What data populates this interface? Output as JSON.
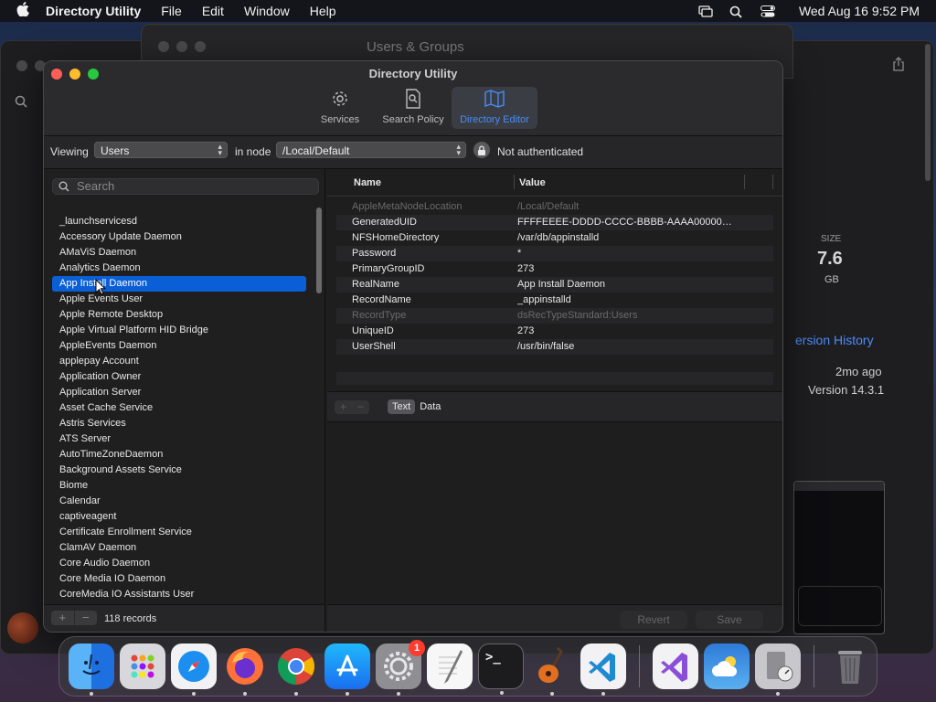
{
  "menubar": {
    "app_name": "Directory Utility",
    "items": [
      "File",
      "Edit",
      "Window",
      "Help"
    ],
    "clock": "Wed Aug 16  9:52 PM"
  },
  "background": {
    "users_groups_title": "Users & Groups",
    "size_label": "SIZE",
    "size_value": "7.6",
    "size_unit": "GB",
    "version_history": "ersion History",
    "ago": "2mo ago",
    "version": "Version 14.3.1"
  },
  "window": {
    "title": "Directory Utility",
    "toolbar": {
      "services": "Services",
      "search_policy": "Search Policy",
      "directory_editor": "Directory Editor"
    },
    "viewing_label": "Viewing",
    "viewing_value": "Users",
    "in_node_label": "in node",
    "node_value": "/Local/Default",
    "auth_status": "Not authenticated"
  },
  "left": {
    "search_placeholder": "Search",
    "records": [
      "_launchservicesd",
      "Accessory Update Daemon",
      "AMaViS Daemon",
      "Analytics Daemon",
      "App Install Daemon",
      "Apple Events User",
      "Apple Remote Desktop",
      "Apple Virtual Platform HID Bridge",
      "AppleEvents Daemon",
      "applepay Account",
      "Application Owner",
      "Application Server",
      "Asset Cache Service",
      "Astris Services",
      "ATS Server",
      "AutoTimeZoneDaemon",
      "Background Assets Service",
      "Biome",
      "Calendar",
      "captiveagent",
      "Certificate Enrollment Service",
      "ClamAV Daemon",
      "Core Audio Daemon",
      "Core Media IO Daemon",
      "CoreMedia IO Assistants User"
    ],
    "selected_index": 4,
    "add": "+",
    "remove": "−",
    "count": "118 records"
  },
  "right": {
    "col_name": "Name",
    "col_value": "Value",
    "attributes": [
      {
        "name": "AppleMetaNodeLocation",
        "value": "/Local/Default",
        "dim": true
      },
      {
        "name": "GeneratedUID",
        "value": "FFFFEEEE-DDDD-CCCC-BBBB-AAAA00000…",
        "dim": false
      },
      {
        "name": "NFSHomeDirectory",
        "value": "/var/db/appinstalld",
        "dim": false
      },
      {
        "name": "Password",
        "value": "*",
        "dim": false
      },
      {
        "name": "PrimaryGroupID",
        "value": "273",
        "dim": false
      },
      {
        "name": "RealName",
        "value": "App Install Daemon",
        "dim": false
      },
      {
        "name": "RecordName",
        "value": "_appinstalld",
        "dim": false
      },
      {
        "name": "RecordType",
        "value": "dsRecTypeStandard:Users",
        "dim": true
      },
      {
        "name": "UniqueID",
        "value": "273",
        "dim": false
      },
      {
        "name": "UserShell",
        "value": "/usr/bin/false",
        "dim": false
      }
    ],
    "add": "+",
    "remove": "−",
    "tab_text": "Text",
    "tab_data": "Data",
    "revert": "Revert",
    "save": "Save"
  },
  "dock": {
    "settings_badge": "1"
  }
}
